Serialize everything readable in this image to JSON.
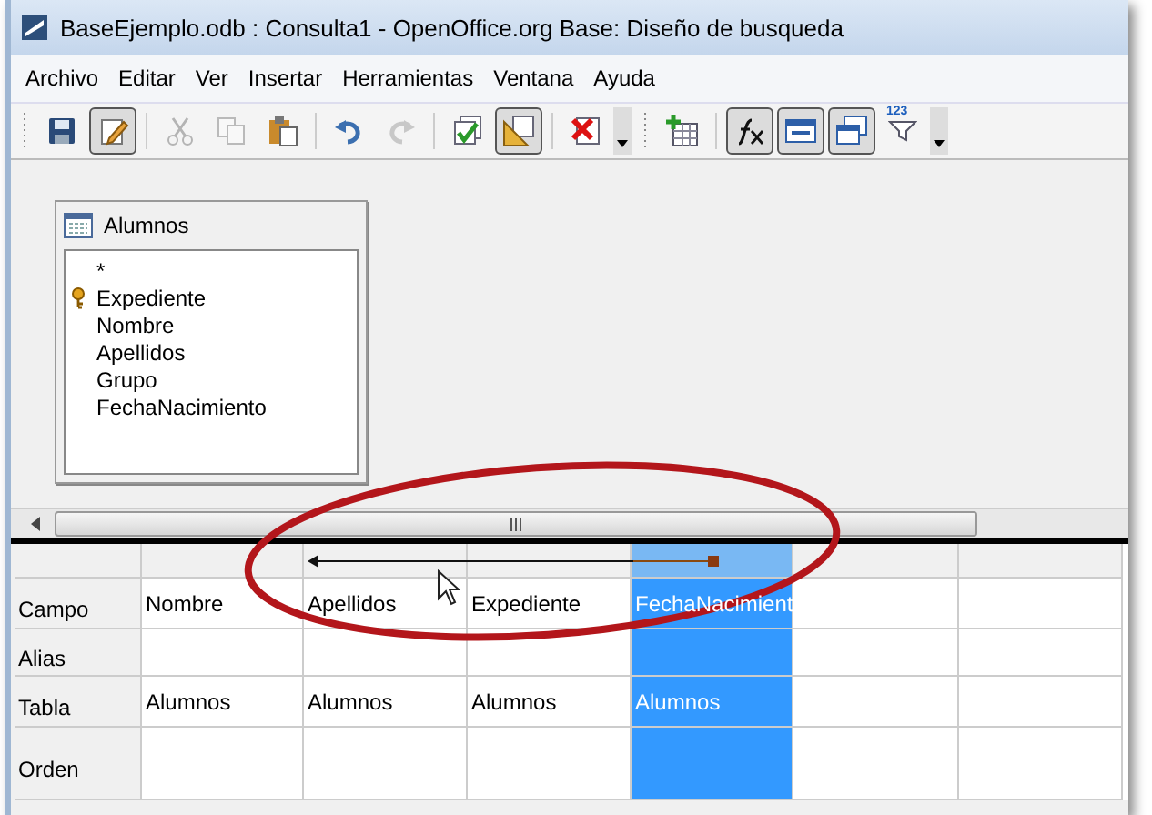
{
  "window": {
    "title": "BaseEjemplo.odb : Consulta1 - OpenOffice.org Base: Diseño de busqueda"
  },
  "menu": [
    {
      "label": "Archivo"
    },
    {
      "label": "Editar"
    },
    {
      "label": "Ver"
    },
    {
      "label": "Insertar"
    },
    {
      "label": "Herramientas"
    },
    {
      "label": "Ventana"
    },
    {
      "label": "Ayuda"
    }
  ],
  "toolbars": [
    [
      {
        "kind": "save",
        "pressed": false,
        "disabled": false
      },
      {
        "kind": "edit",
        "pressed": true,
        "disabled": false
      },
      {
        "kind": "sep"
      },
      {
        "kind": "cut",
        "pressed": false,
        "disabled": true
      },
      {
        "kind": "copy",
        "pressed": false,
        "disabled": true
      },
      {
        "kind": "paste",
        "pressed": false,
        "disabled": false
      },
      {
        "kind": "sep"
      },
      {
        "kind": "undo",
        "pressed": false,
        "disabled": false
      },
      {
        "kind": "redo",
        "pressed": false,
        "disabled": true
      },
      {
        "kind": "sep"
      },
      {
        "kind": "run",
        "pressed": false,
        "disabled": false
      },
      {
        "kind": "design",
        "pressed": true,
        "disabled": false
      },
      {
        "kind": "sep"
      },
      {
        "kind": "clear",
        "pressed": false,
        "disabled": false
      },
      {
        "kind": "more"
      }
    ],
    [
      {
        "kind": "addtable",
        "pressed": false,
        "disabled": false
      },
      {
        "kind": "sep"
      },
      {
        "kind": "functions",
        "pressed": true,
        "disabled": false
      },
      {
        "kind": "alias",
        "pressed": true,
        "disabled": false
      },
      {
        "kind": "tablenames",
        "pressed": true,
        "disabled": false
      },
      {
        "kind": "filter",
        "pressed": false,
        "disabled": false,
        "badge": "123"
      },
      {
        "kind": "more"
      }
    ]
  ],
  "table_window": {
    "title": "Alumnos",
    "fields": [
      {
        "name": "*",
        "key": false
      },
      {
        "name": "Expediente",
        "key": true
      },
      {
        "name": "Nombre",
        "key": false
      },
      {
        "name": "Apellidos",
        "key": false
      },
      {
        "name": "Grupo",
        "key": false
      },
      {
        "name": "FechaNacimiento",
        "key": false
      }
    ]
  },
  "grid": {
    "row_labels": [
      "Campo",
      "Alias",
      "Tabla",
      "Orden"
    ],
    "columns": [
      {
        "campo": "Nombre",
        "tabla": "Alumnos",
        "selected": false
      },
      {
        "campo": "Apellidos",
        "tabla": "Alumnos",
        "selected": false
      },
      {
        "campo": "Expediente",
        "tabla": "Alumnos",
        "selected": false
      },
      {
        "campo": "FechaNacimient",
        "tabla": "Alumnos",
        "selected": true
      },
      {
        "selected": false
      },
      {
        "selected": false
      }
    ]
  }
}
